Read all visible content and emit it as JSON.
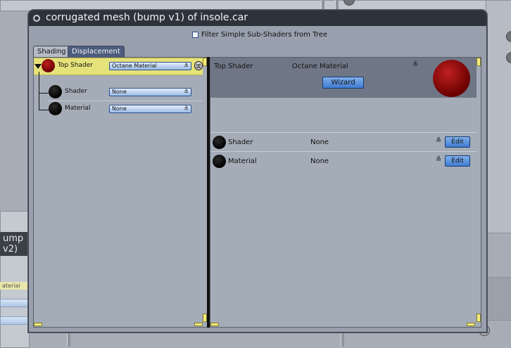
{
  "background": {
    "left_window_label": "ump v2)",
    "strip_label": "aterial"
  },
  "dialog": {
    "title": "corrugated mesh (bump v1) of insole.car",
    "filter_label": "Filter Simple Sub-Shaders from Tree",
    "tabs": [
      {
        "label": "Shading"
      },
      {
        "label": "Displacement"
      }
    ]
  },
  "tree": {
    "rows": [
      {
        "label": "Top Shader",
        "value": "Octane Material",
        "ball": "red",
        "selected": true
      },
      {
        "label": "Shader",
        "value": "None",
        "ball": "black",
        "selected": false
      },
      {
        "label": "Material",
        "value": "None",
        "ball": "black",
        "selected": false
      }
    ]
  },
  "detail": {
    "top_label": "Top Shader",
    "top_value": "Octane Material",
    "wizard_label": "Wizard",
    "rows": [
      {
        "label": "Shader",
        "value": "None",
        "edit_label": "Edit"
      },
      {
        "label": "Material",
        "value": "None",
        "edit_label": "Edit"
      }
    ]
  },
  "icons": {
    "dropdown": "chevron-down-icon",
    "double_chevron": "double-chevron-down-icon",
    "trash": "trash-icon"
  },
  "colors": {
    "titlebar": "#2e323a",
    "selected_row": "#e6e27a",
    "button_blue": "#5b93de",
    "header_band": "#6f7787"
  }
}
